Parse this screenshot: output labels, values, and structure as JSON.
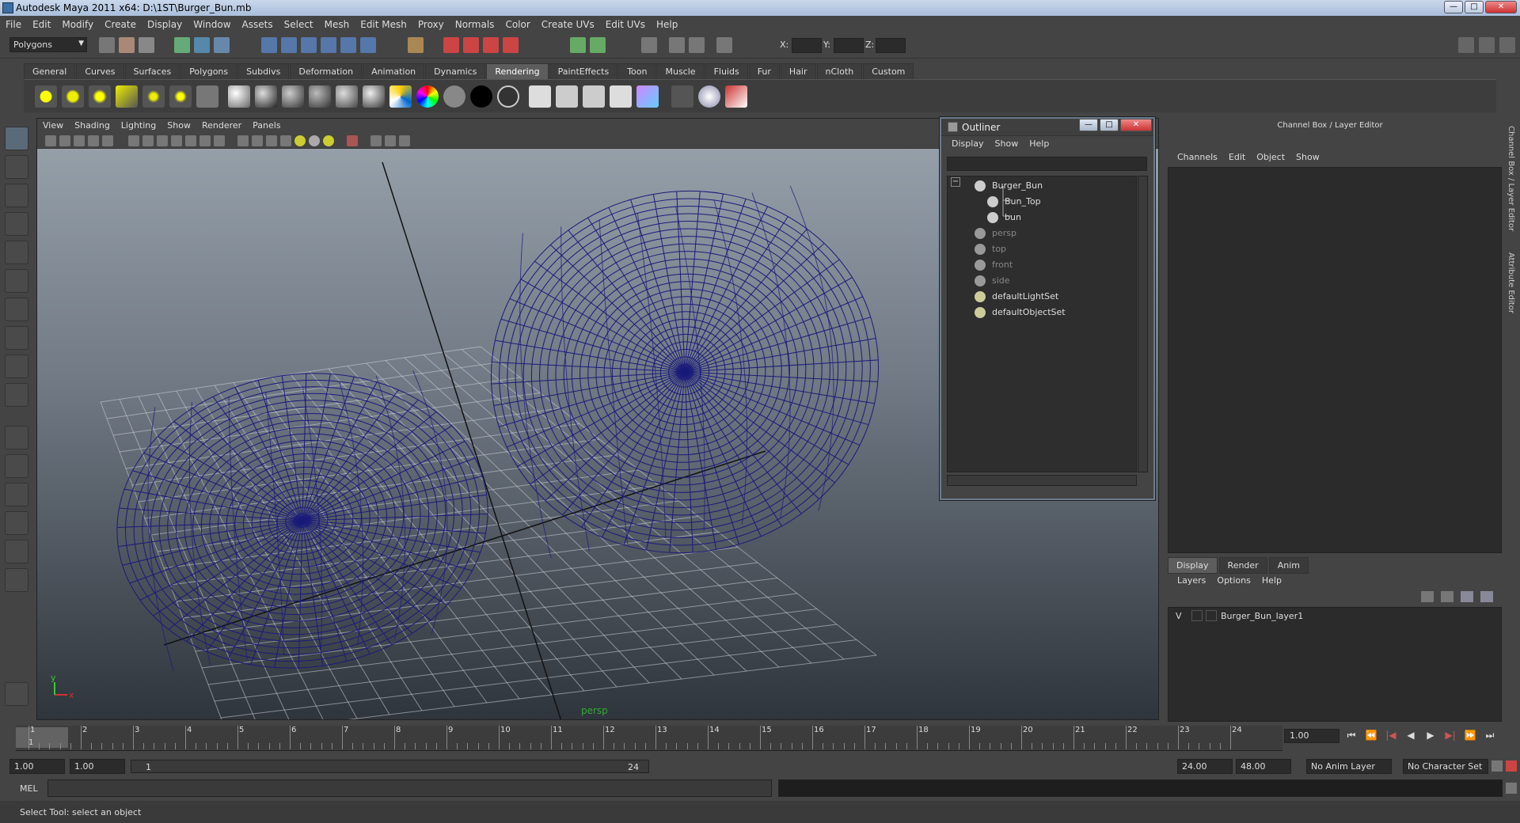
{
  "window": {
    "title": "Autodesk Maya 2011 x64: D:\\1ST\\Burger_Bun.mb",
    "btn_min": "—",
    "btn_max": "□",
    "btn_close": "✕"
  },
  "menubar": [
    "File",
    "Edit",
    "Modify",
    "Create",
    "Display",
    "Window",
    "Assets",
    "Select",
    "Mesh",
    "Edit Mesh",
    "Proxy",
    "Normals",
    "Color",
    "Create UVs",
    "Edit UVs",
    "Help"
  ],
  "toolbar": {
    "mode": "Polygons",
    "x_label": "X:",
    "y_label": "Y:",
    "z_label": "Z:"
  },
  "shelf": {
    "tabs": [
      "General",
      "Curves",
      "Surfaces",
      "Polygons",
      "Subdivs",
      "Deformation",
      "Animation",
      "Dynamics",
      "Rendering",
      "PaintEffects",
      "Toon",
      "Muscle",
      "Fluids",
      "Fur",
      "Hair",
      "nCloth",
      "Custom"
    ],
    "active_tab": "Rendering"
  },
  "viewport": {
    "menu": [
      "View",
      "Shading",
      "Lighting",
      "Show",
      "Renderer",
      "Panels"
    ],
    "camera_label": "persp",
    "axis_x": "x",
    "axis_y": "y",
    "wire_color": "#1a1a7a"
  },
  "outliner": {
    "title": "Outliner",
    "menu": [
      "Display",
      "Show",
      "Help"
    ],
    "items": [
      {
        "label": "Burger_Bun",
        "dim": false
      },
      {
        "label": "Bun_Top",
        "dim": false
      },
      {
        "label": "bun",
        "dim": false
      },
      {
        "label": "persp",
        "dim": true
      },
      {
        "label": "top",
        "dim": true
      },
      {
        "label": "front",
        "dim": true
      },
      {
        "label": "side",
        "dim": true
      },
      {
        "label": "defaultLightSet",
        "dim": false
      },
      {
        "label": "defaultObjectSet",
        "dim": false
      }
    ],
    "collapse_symbol": "−"
  },
  "channelbox": {
    "title": "Channel Box / Layer Editor",
    "menu": [
      "Channels",
      "Edit",
      "Object",
      "Show"
    ],
    "layer_tabs": [
      "Display",
      "Render",
      "Anim"
    ],
    "active_layer_tab": "Display",
    "layer_menu": [
      "Layers",
      "Options",
      "Help"
    ],
    "layer": {
      "visible": "V",
      "name": "Burger_Bun_layer1"
    },
    "side_tab_1": "Channel Box / Layer Editor",
    "side_tab_2": "Attribute Editor"
  },
  "timeline": {
    "ticks": [
      "1",
      "2",
      "3",
      "4",
      "5",
      "6",
      "7",
      "8",
      "9",
      "10",
      "11",
      "12",
      "13",
      "14",
      "15",
      "16",
      "17",
      "18",
      "19",
      "20",
      "21",
      "22",
      "23",
      "24"
    ],
    "current_frame_marker": "1",
    "current_time": "1.00"
  },
  "range": {
    "start_time": "1.00",
    "playback_start": "1.00",
    "slider_start": "1",
    "slider_end": "24",
    "playback_end": "24.00",
    "end_time": "48.00",
    "anim_layer": "No Anim Layer",
    "character_set": "No Character Set"
  },
  "mel": {
    "label": "MEL"
  },
  "status": {
    "help_line": "Select Tool: select an object"
  }
}
